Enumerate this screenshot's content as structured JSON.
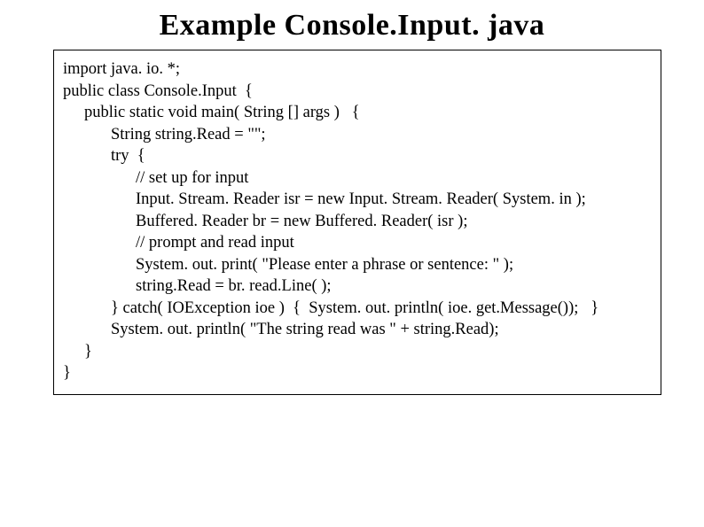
{
  "title": "Example Console.Input. java",
  "code": {
    "l1": "import java. io. *;",
    "l2": "public class Console.Input  {",
    "l3": "public static void main( String [] args )   {",
    "l4": "String string.Read = \"\";",
    "l5": "try  {",
    "l6": "// set up for input",
    "l7": "Input. Stream. Reader isr = new Input. Stream. Reader( System. in );",
    "l8": "Buffered. Reader br = new Buffered. Reader( isr );",
    "l9": "// prompt and read input",
    "l10": "System. out. print( \"Please enter a phrase or sentence: \" );",
    "l11": "string.Read = br. read.Line( );",
    "l12": "} catch( IOException ioe )  {  System. out. println( ioe. get.Message());   }",
    "l13": "System. out. println( \"The string read was \" + string.Read);",
    "l14": "}",
    "l15": "}"
  }
}
